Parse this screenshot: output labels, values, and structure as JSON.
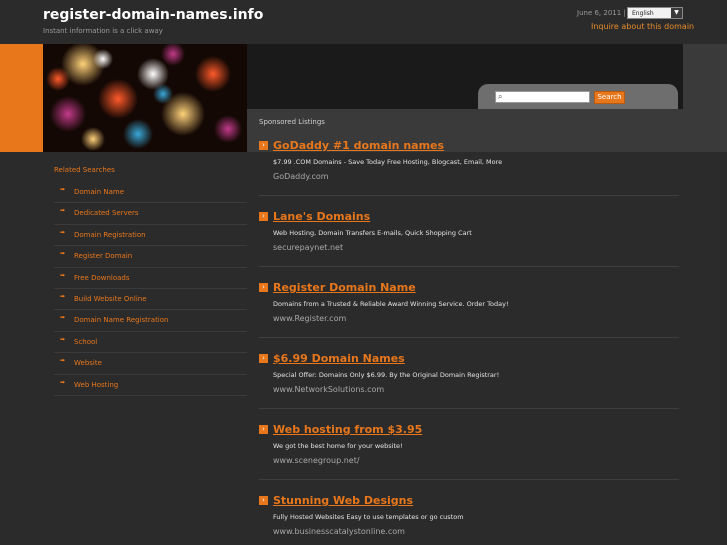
{
  "header": {
    "site_title": "register-domain-names.info",
    "tagline": "Instant information is a click away",
    "date": "June 6, 2011 |",
    "language": "English",
    "inquire": "Inquire about this domain"
  },
  "search": {
    "button_label": "Search",
    "placeholder": ""
  },
  "sidebar": {
    "title": "Related Searches",
    "items": [
      "Domain Name",
      "Dedicated Servers",
      "Domain Registration",
      "Register Domain",
      "Free Downloads",
      "Build Website Online",
      "Domain Name Registration",
      "School",
      "Website",
      "Web Hosting"
    ]
  },
  "main": {
    "sponsored_title": "Sponsored Listings",
    "listings": [
      {
        "title": "GoDaddy #1 domain names",
        "desc": "$7.99 .COM Domains - Save Today Free Hosting, Blogcast, Email, More",
        "url": "GoDaddy.com"
      },
      {
        "title": "Lane's Domains",
        "desc": "Web Hosting, Domain Transfers E-mails, Quick Shopping Cart",
        "url": "securepaynet.net"
      },
      {
        "title": "Register Domain Name",
        "desc": "Domains from a Trusted & Reliable Award Winning Service. Order Today!",
        "url": "www.Register.com"
      },
      {
        "title": "$6.99 Domain Names",
        "desc": "Special Offer: Domains Only $6.99. By the Original Domain Registrar!",
        "url": "www.NetworkSolutions.com"
      },
      {
        "title": "Web hosting from $3.95",
        "desc": "We got the best home for your website!",
        "url": "www.scenegroup.net/"
      },
      {
        "title": "Stunning Web Designs",
        "desc": "Fully Hosted Websites Easy to use templates or go custom",
        "url": "www.businesscatalystonline.com"
      }
    ]
  },
  "colors": {
    "accent": "#e8771c",
    "background": "#2b2b2b",
    "panel": "#3a3a3a"
  }
}
